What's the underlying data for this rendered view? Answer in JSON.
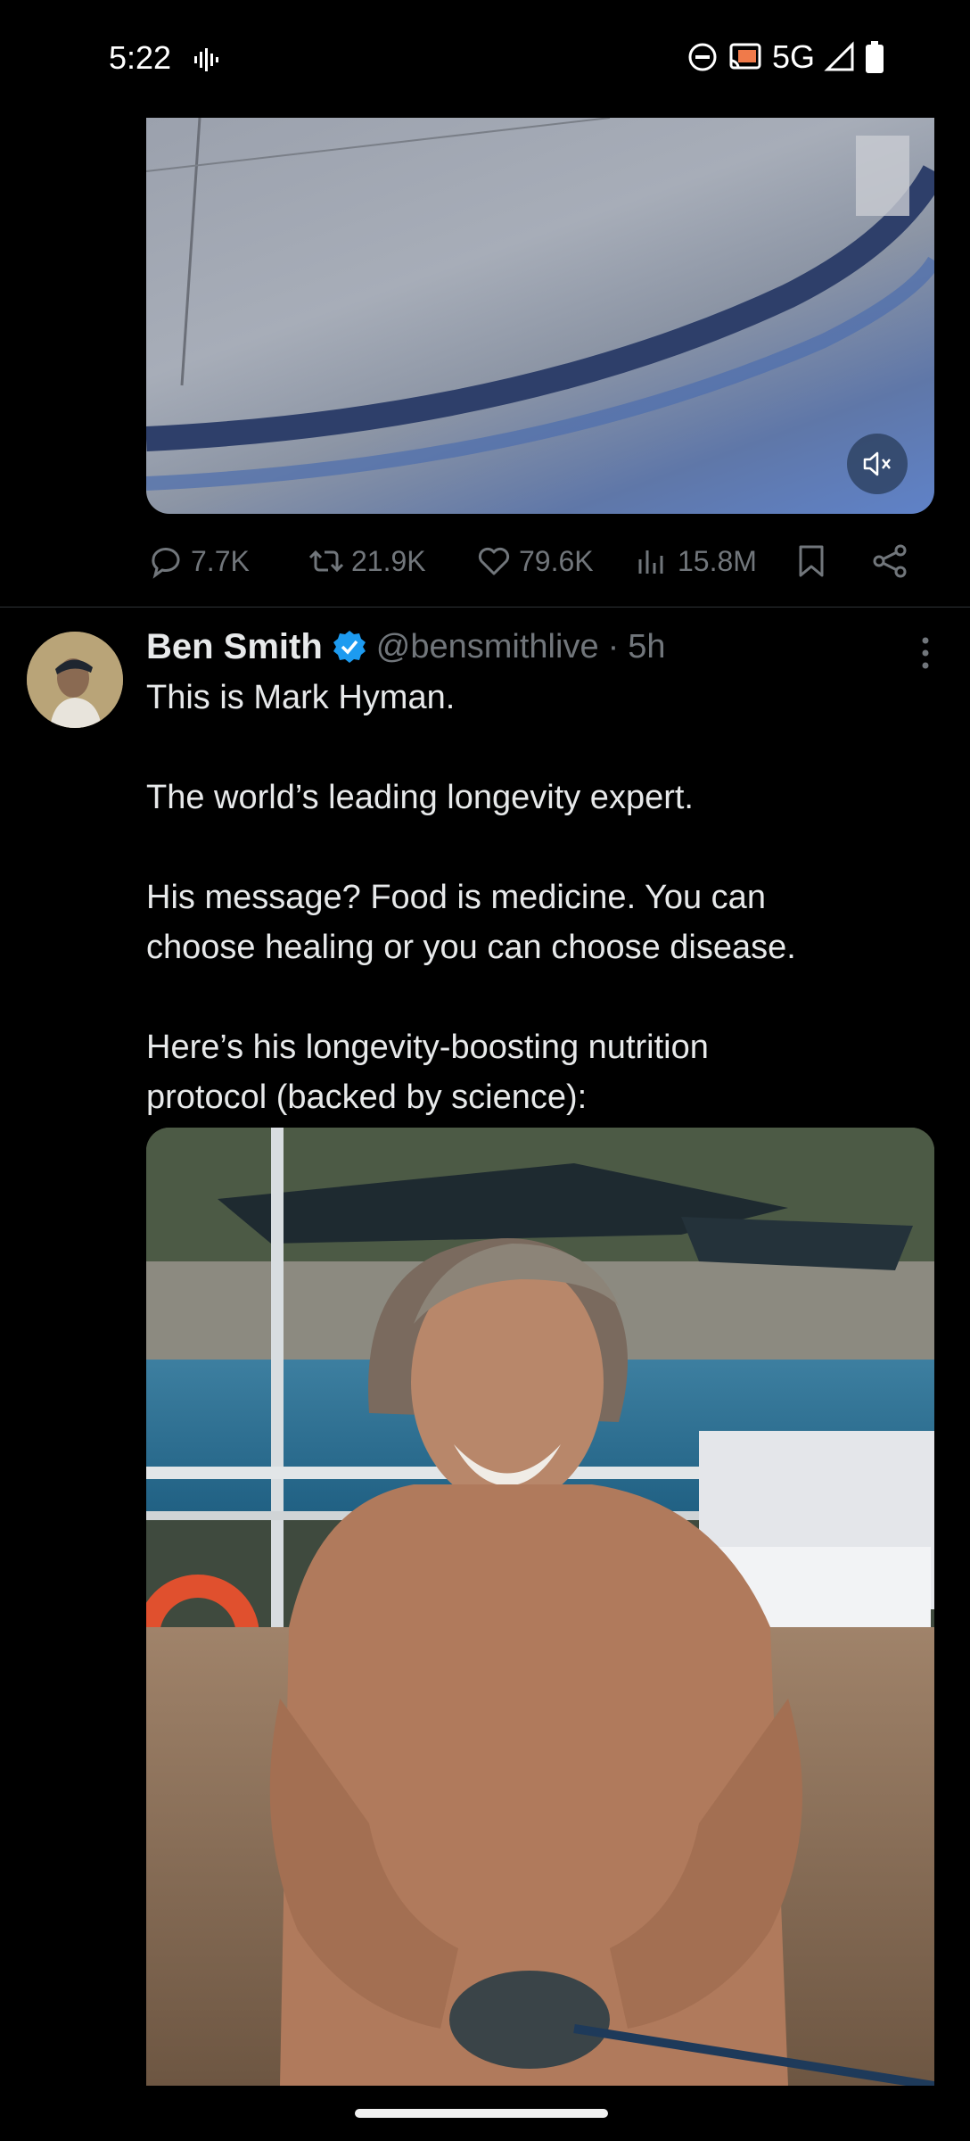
{
  "status_bar": {
    "time": "5:22",
    "network": "5G",
    "icons": [
      "voice-wave-icon",
      "do-not-disturb-icon",
      "cast-icon",
      "signal-icon",
      "battery-icon"
    ]
  },
  "top_post": {
    "media": {
      "muted": true,
      "mute_icon": "speaker-muted-icon"
    },
    "actions": {
      "replies": "7.7K",
      "reposts": "21.9K",
      "likes": "79.6K",
      "views": "15.8M"
    }
  },
  "tweet": {
    "author_name": "Ben Smith",
    "verified": true,
    "handle": "@bensmithlive",
    "separator": "·",
    "time_ago": "5h",
    "text_lines": [
      "This is Mark Hyman.",
      "",
      "The world’s leading longevity expert.",
      "",
      "His message? Food is medicine. You can",
      "choose healing or you can choose disease.",
      "",
      "Here’s his longevity-boosting nutrition",
      "protocol (backed by science):"
    ]
  },
  "colors": {
    "background": "#000000",
    "text_primary": "#e7e9ea",
    "text_secondary": "#71767b",
    "verified_blue": "#1d9bf0"
  }
}
